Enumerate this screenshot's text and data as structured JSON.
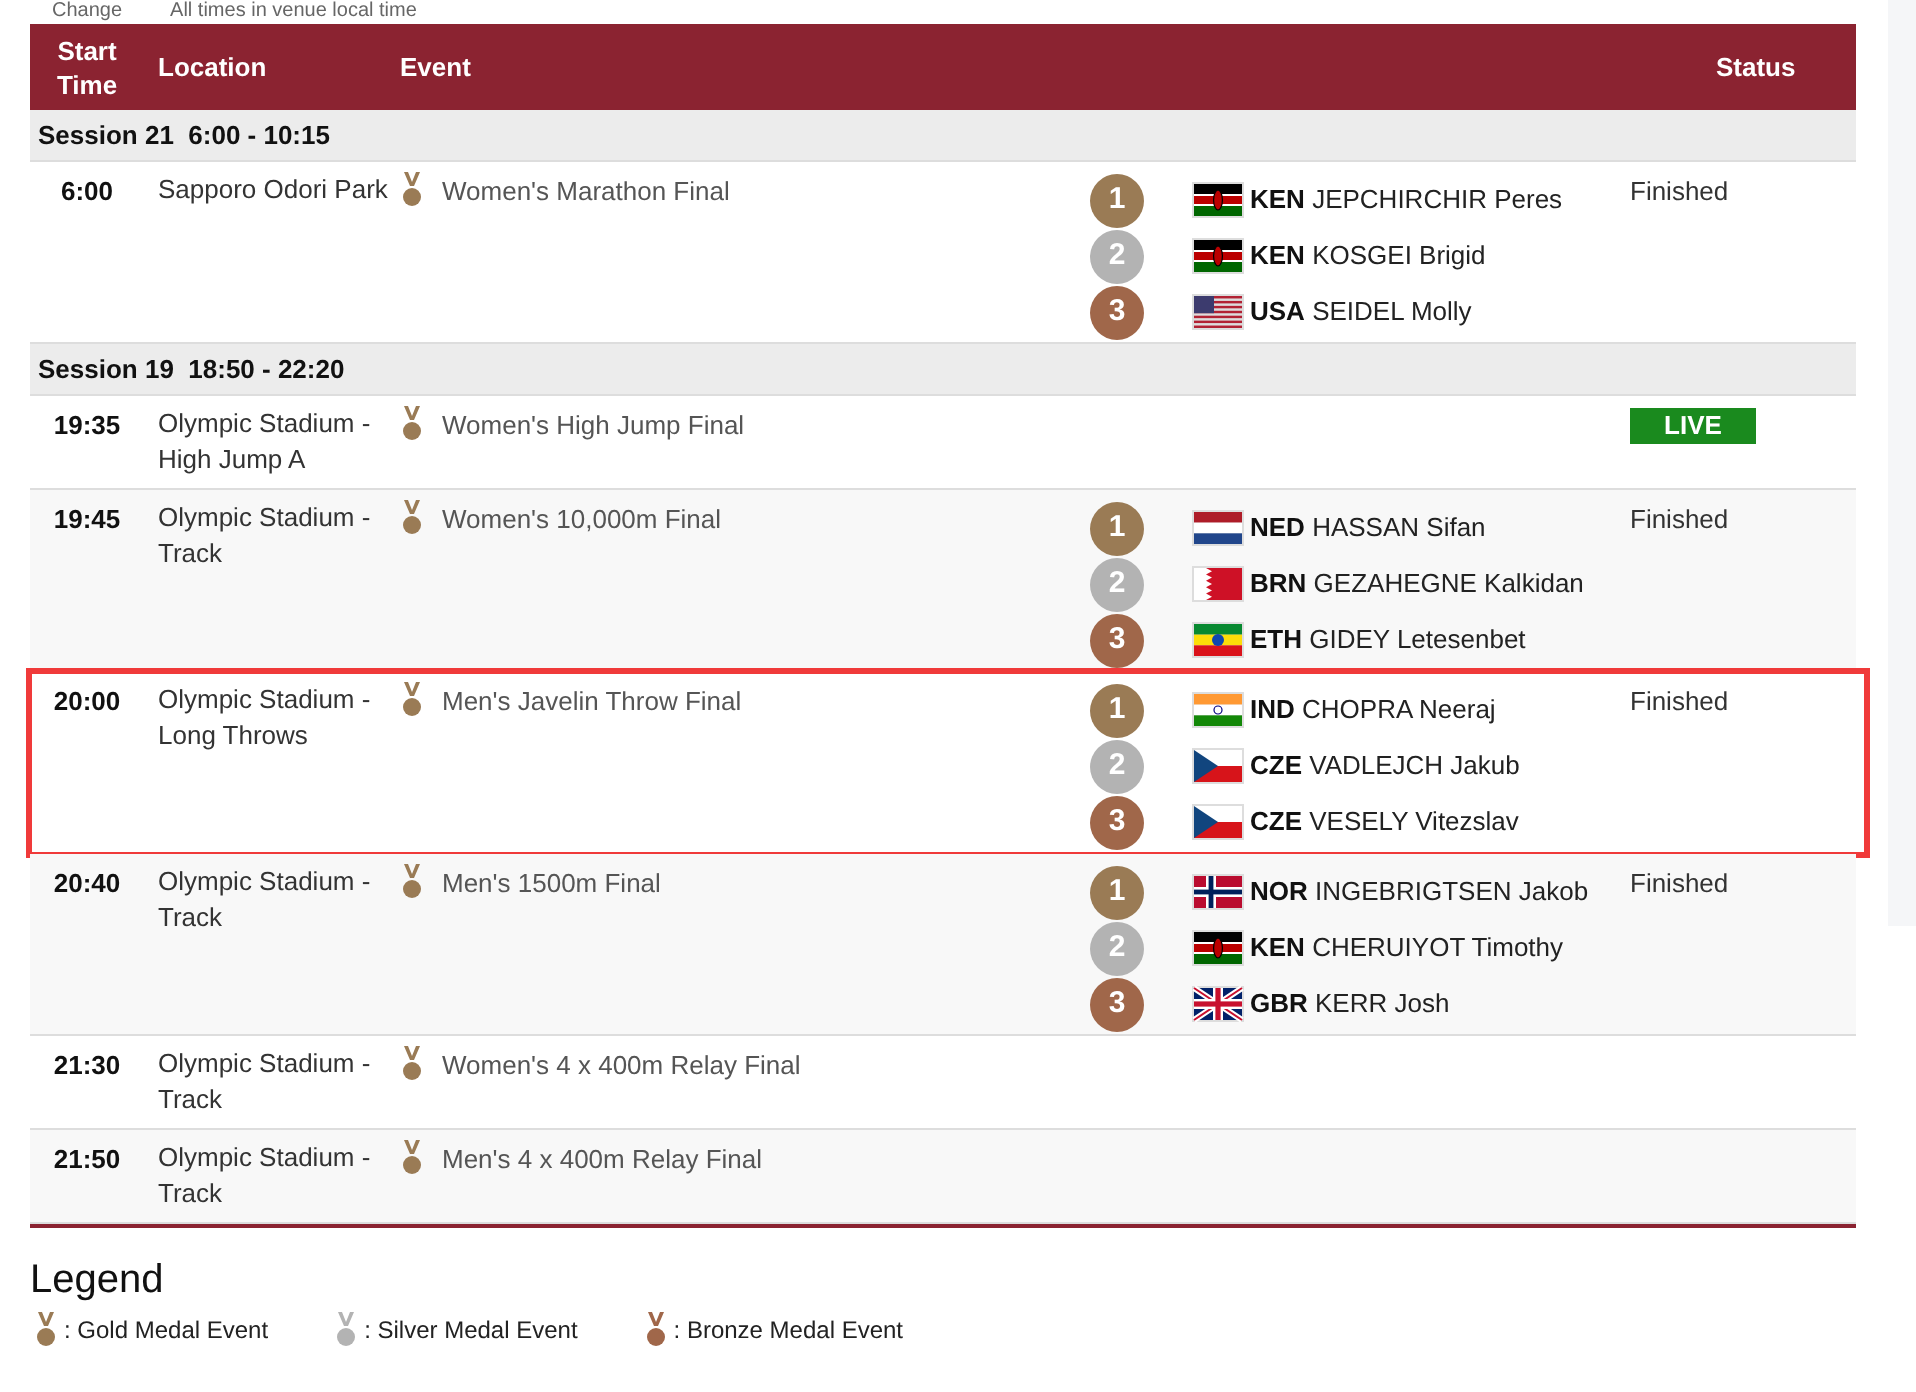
{
  "top_bar": {
    "change_link": "Change",
    "timezone_note": "All times in venue local time"
  },
  "table": {
    "columns": [
      "Start Time",
      "Location",
      "Event",
      "Status"
    ],
    "sessions": [
      {
        "title": "Session 21  6:00 - 10:15",
        "rows": [
          {
            "time": "6:00",
            "location": "Sapporo Odori Park",
            "event": "Women's Marathon Final",
            "highlighted": false,
            "status": {
              "kind": "text",
              "text": "Finished"
            },
            "results": [
              {
                "place": "1",
                "flag": {
                  "kind": "kenya"
                },
                "noc": "KEN",
                "name": "JEPCHIRCHIR Peres"
              },
              {
                "place": "2",
                "flag": {
                  "kind": "kenya"
                },
                "noc": "KEN",
                "name": "KOSGEI Brigid"
              },
              {
                "place": "3",
                "flag": {
                  "kind": "usa"
                },
                "noc": "USA",
                "name": "SEIDEL Molly"
              }
            ]
          }
        ]
      },
      {
        "title": "Session 19  18:50 - 22:20",
        "rows": [
          {
            "time": "19:35",
            "location": "Olympic Stadium - High Jump A",
            "event": "Women's High Jump Final",
            "highlighted": false,
            "status": {
              "kind": "live",
              "text": "LIVE"
            }
          },
          {
            "time": "19:45",
            "location": "Olympic Stadium - Track",
            "event": "Women's 10,000m Final",
            "highlighted": false,
            "status": {
              "kind": "text",
              "text": "Finished"
            },
            "results": [
              {
                "place": "1",
                "flag": {
                  "kind": "netherlands"
                },
                "noc": "NED",
                "name": "HASSAN Sifan"
              },
              {
                "place": "2",
                "flag": {
                  "kind": "bahrain"
                },
                "noc": "BRN",
                "name": "GEZAHEGNE Kalkidan"
              },
              {
                "place": "3",
                "flag": {
                  "kind": "ethiopia"
                },
                "noc": "ETH",
                "name": "GIDEY Letesenbet"
              }
            ]
          },
          {
            "time": "20:00",
            "location": "Olympic Stadium - Long Throws",
            "event": "Men's Javelin Throw Final",
            "highlighted": true,
            "status": {
              "kind": "text",
              "text": "Finished"
            },
            "results": [
              {
                "place": "1",
                "flag": {
                  "kind": "india"
                },
                "noc": "IND",
                "name": "CHOPRA Neeraj"
              },
              {
                "place": "2",
                "flag": {
                  "kind": "czechia"
                },
                "noc": "CZE",
                "name": "VADLEJCH Jakub"
              },
              {
                "place": "3",
                "flag": {
                  "kind": "czechia"
                },
                "noc": "CZE",
                "name": "VESELY Vitezslav"
              }
            ]
          },
          {
            "time": "20:40",
            "location": "Olympic Stadium - Track",
            "event": "Men's 1500m Final",
            "highlighted": false,
            "status": {
              "kind": "text",
              "text": "Finished"
            },
            "results": [
              {
                "place": "1",
                "flag": {
                  "kind": "norway"
                },
                "noc": "NOR",
                "name": "INGEBRIGTSEN Jakob"
              },
              {
                "place": "2",
                "flag": {
                  "kind": "kenya"
                },
                "noc": "KEN",
                "name": "CHERUIYOT Timothy"
              },
              {
                "place": "3",
                "flag": {
                  "kind": "uk"
                },
                "noc": "GBR",
                "name": "KERR Josh"
              }
            ]
          },
          {
            "time": "21:30",
            "location": "Olympic Stadium - Track",
            "event": "Women's 4 x 400m Relay Final",
            "highlighted": false
          },
          {
            "time": "21:50",
            "location": "Olympic Stadium - Track",
            "event": "Men's 4 x 400m Relay Final",
            "highlighted": false
          }
        ]
      }
    ]
  },
  "legend": {
    "title": "Legend",
    "items": [
      {
        "kind": "gold",
        "label": ": Gold Medal Event"
      },
      {
        "kind": "silver",
        "label": ": Silver Medal Event"
      },
      {
        "kind": "bronze",
        "label": ": Bronze Medal Event"
      }
    ]
  }
}
